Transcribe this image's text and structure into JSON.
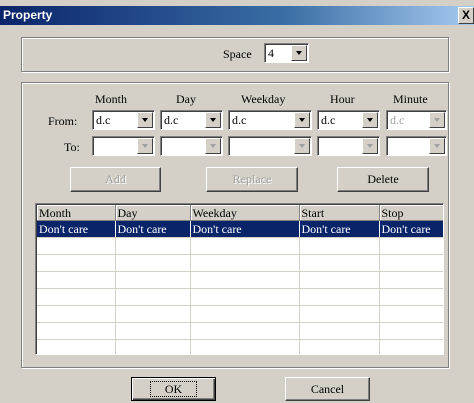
{
  "dialog": {
    "title": "Property",
    "close_glyph": "X"
  },
  "space": {
    "label": "Space",
    "value": "4"
  },
  "columns_labels": {
    "month": "Month",
    "day": "Day",
    "weekday": "Weekday",
    "hour": "Hour",
    "minute": "Minute"
  },
  "from": {
    "label": "From:",
    "month": "d.c",
    "day": "d.c",
    "weekday": "d.c",
    "hour": "d.c",
    "minute": "d.c"
  },
  "to": {
    "label": "To:"
  },
  "buttons": {
    "add": "Add",
    "replace": "Replace",
    "delete": "Delete",
    "ok": "OK",
    "cancel": "Cancel"
  },
  "table": {
    "headers": [
      "Month",
      "Day",
      "Weekday",
      "Start",
      "Stop"
    ],
    "rows": [
      [
        "Don't care",
        "Don't care",
        "Don't care",
        "Don't care",
        "Don't care"
      ]
    ]
  },
  "colors": {
    "face": "#d4d0c8",
    "selection": "#0a246a",
    "title_gradient_start": "#0a246a"
  },
  "icons": {
    "close": "close-icon",
    "dropdown": "chevron-down-icon"
  }
}
